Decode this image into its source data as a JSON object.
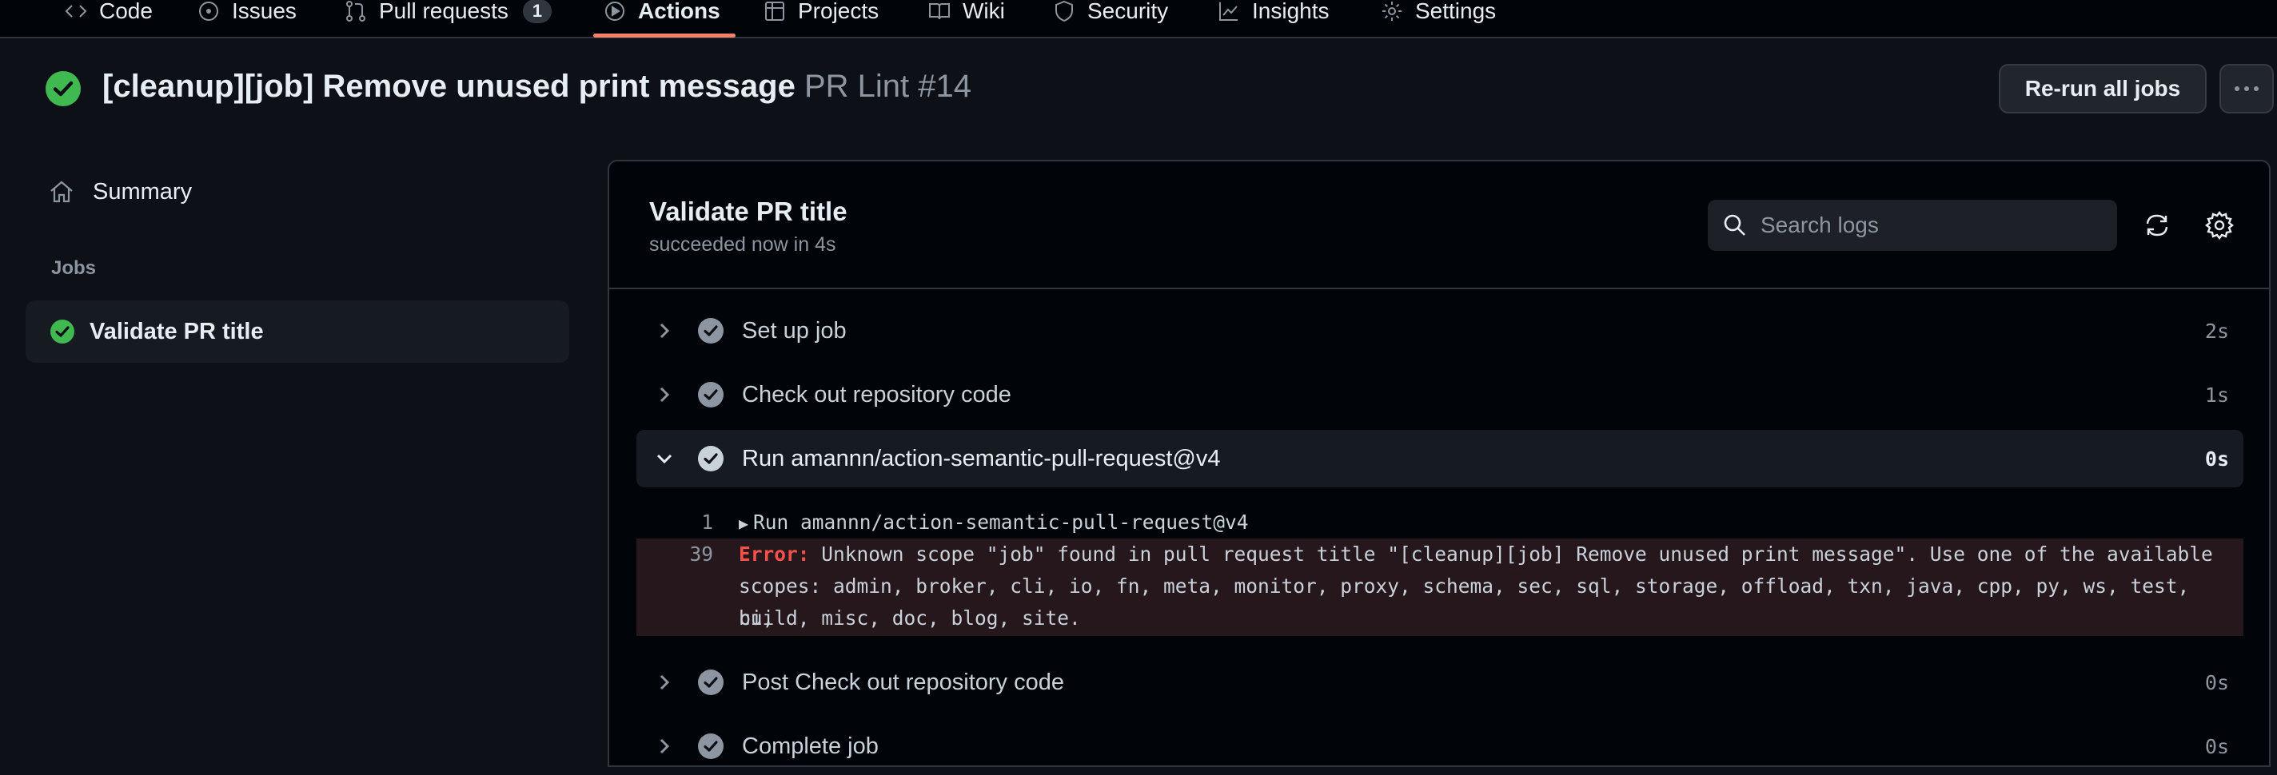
{
  "nav": {
    "tabs": [
      {
        "label": "Code",
        "icon": "code-icon"
      },
      {
        "label": "Issues",
        "icon": "issue-icon"
      },
      {
        "label": "Pull requests",
        "icon": "pull-request-icon",
        "counter": "1"
      },
      {
        "label": "Actions",
        "icon": "play-icon",
        "active": true
      },
      {
        "label": "Projects",
        "icon": "table-icon"
      },
      {
        "label": "Wiki",
        "icon": "book-icon"
      },
      {
        "label": "Security",
        "icon": "shield-icon"
      },
      {
        "label": "Insights",
        "icon": "graph-icon"
      },
      {
        "label": "Settings",
        "icon": "gear-icon"
      }
    ],
    "active_color": "#f78166"
  },
  "run": {
    "title": "[cleanup][job] Remove unused print message",
    "subtitle": "PR Lint #14",
    "status_icon": "check-circle-fill-icon",
    "status_color": "#3fb950",
    "rerun_label": "Re-run all jobs"
  },
  "sidebar": {
    "summary_label": "Summary",
    "jobs_heading": "Jobs",
    "jobs": [
      {
        "label": "Validate PR title",
        "status": "success"
      }
    ]
  },
  "log": {
    "title": "Validate PR title",
    "status": "succeeded now in 4s",
    "search_placeholder": "Search logs",
    "steps": [
      {
        "name": "Set up job",
        "duration": "2s",
        "expanded": false
      },
      {
        "name": "Check out repository code",
        "duration": "1s",
        "expanded": false
      },
      {
        "name": "Run amannn/action-semantic-pull-request@v4",
        "duration": "0s",
        "expanded": true
      },
      {
        "name": "Post Check out repository code",
        "duration": "0s",
        "expanded": false
      },
      {
        "name": "Complete job",
        "duration": "0s",
        "expanded": false
      }
    ],
    "lines": [
      {
        "number": "1",
        "text": "Run amannn/action-semantic-pull-request@v4"
      },
      {
        "number": "39",
        "error_label": "Error:",
        "text_1": " Unknown scope \"job\" found in pull request title \"[cleanup][job] Remove unused print message\". Use one of the available",
        "text_2": "scopes: admin, broker, cli, io, fn, meta, monitor, proxy, schema, sec, sql, storage, offload, txn, java, cpp, py, ws, test, ci,",
        "text_3": "build, misc, doc, blog, site."
      }
    ],
    "error_color": "#f85149"
  }
}
